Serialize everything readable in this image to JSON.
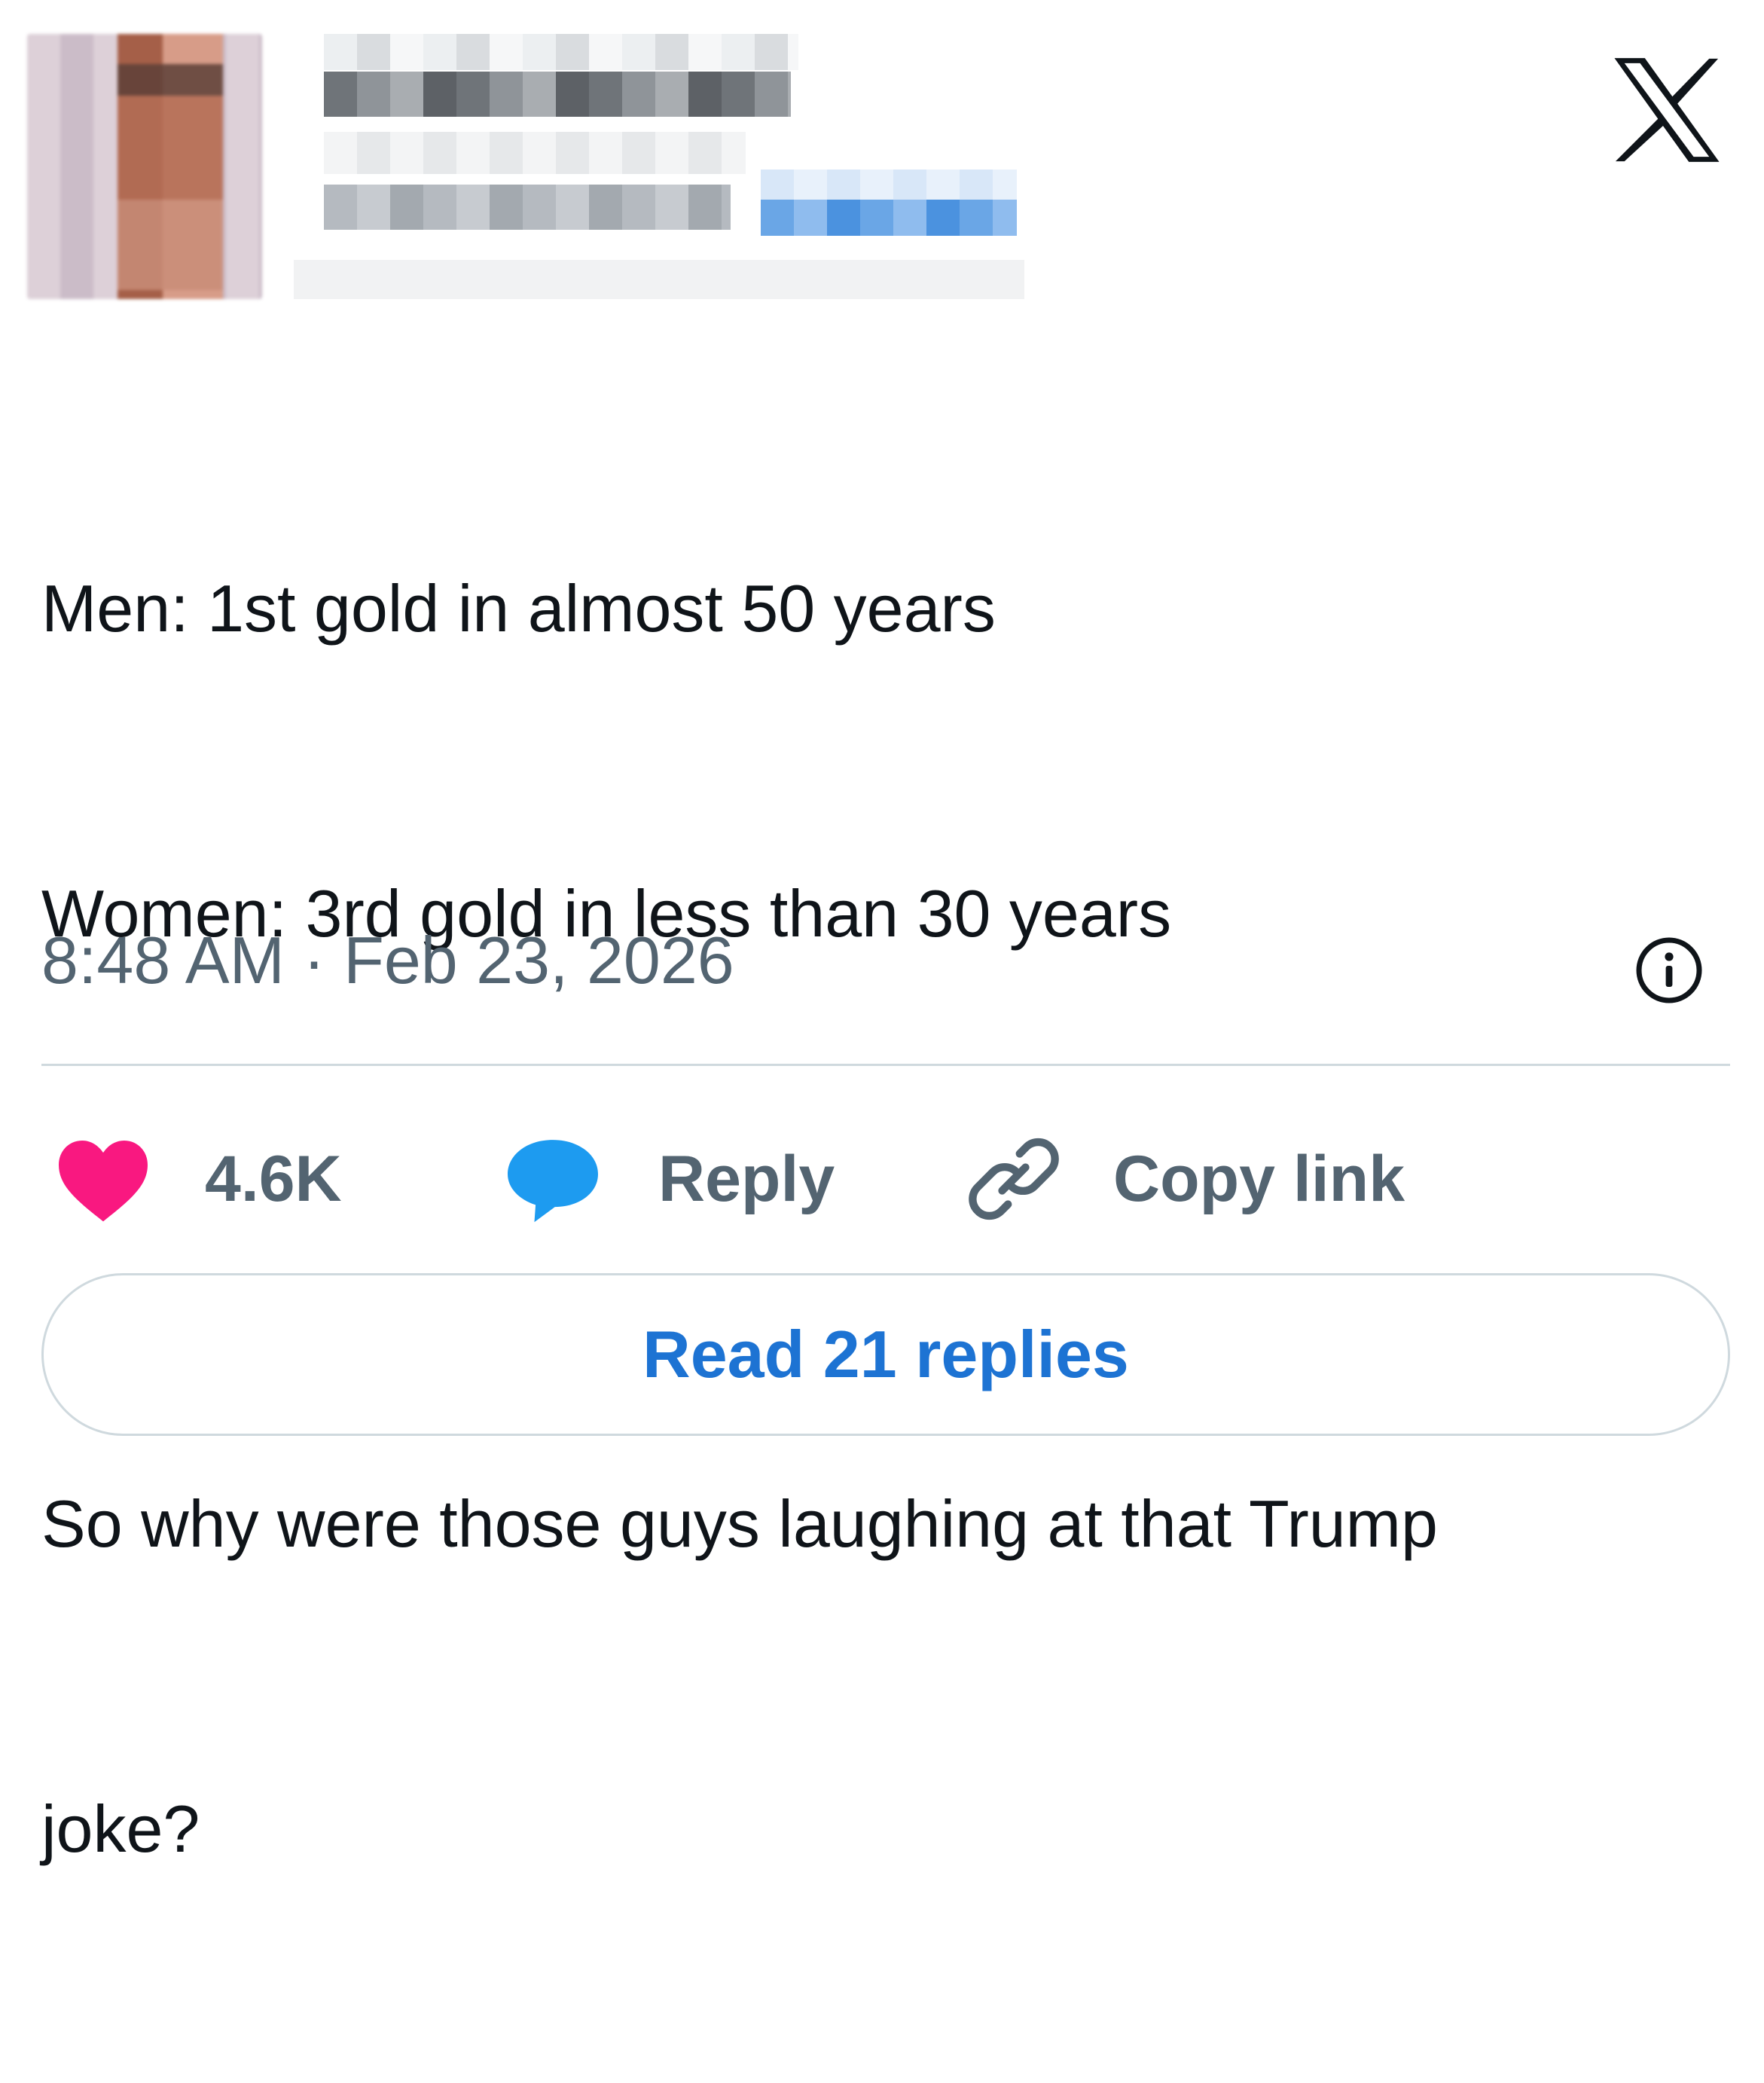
{
  "tweet": {
    "author": {
      "avatar_icon": "avatar-pixelated",
      "name_redacted": true,
      "handle_redacted": true
    },
    "brand_icon": "x-logo-icon",
    "text_line1": "Men: 1st gold in almost 50 years",
    "text_line2": "Women: 3rd gold in less than 30 years",
    "text_line3": "",
    "text_line4": "So why were those guys laughing at that Trump",
    "text_line5": "joke?",
    "timestamp": "8:48 AM · Feb 23, 2026",
    "info_icon": "info-icon"
  },
  "actions": {
    "like_icon": "heart-icon",
    "like_count": "4.6K",
    "reply_icon": "speech-bubble-icon",
    "reply_label": "Reply",
    "copy_icon": "link-icon",
    "copy_label": "Copy link"
  },
  "read_replies_label": "Read 21 replies",
  "colors": {
    "text": "#0f1419",
    "muted": "#536471",
    "heart": "#f91880",
    "reply_blue": "#1d9bf0",
    "link_blue": "#1d73d3",
    "border": "#cfd9de"
  }
}
